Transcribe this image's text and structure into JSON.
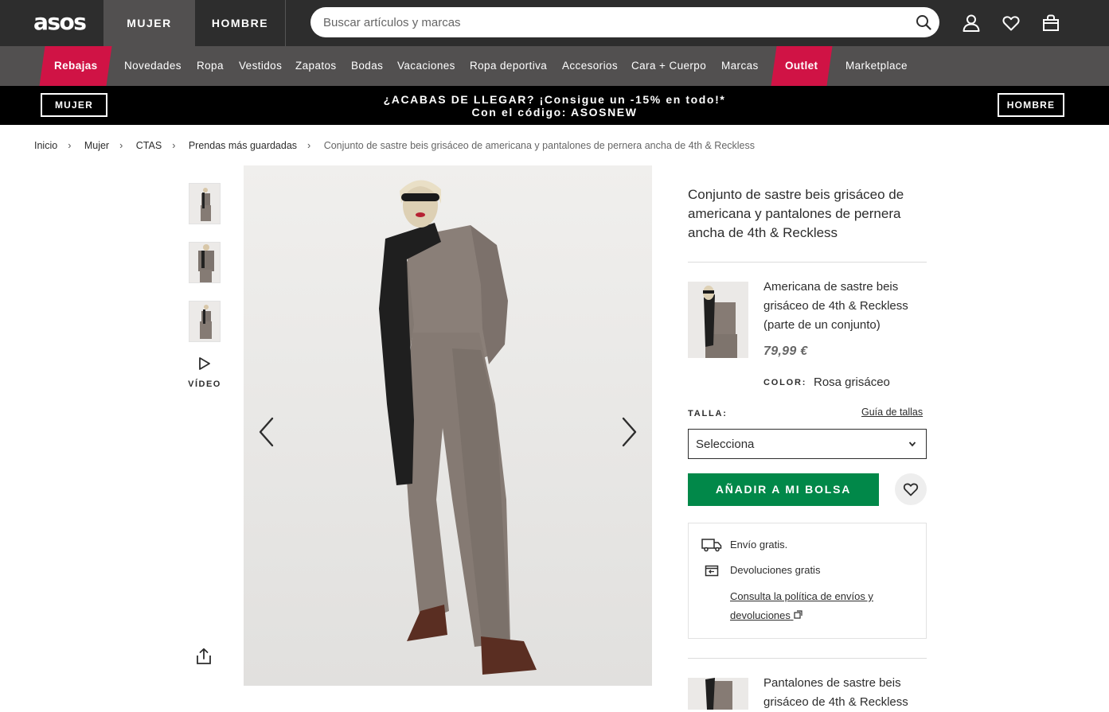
{
  "header": {
    "logo": "asos",
    "tabs": [
      "MUJER",
      "HOMBRE"
    ],
    "search_placeholder": "Buscar artículos y marcas",
    "icons": [
      "account-icon",
      "heart-icon",
      "bag-icon"
    ]
  },
  "categories": {
    "items": [
      "Rebajas",
      "Novedades",
      "Ropa",
      "Vestidos",
      "Zapatos",
      "Bodas",
      "Vacaciones",
      "Ropa deportiva",
      "Accesorios",
      "Cara + Cuerpo",
      "Marcas",
      "Outlet",
      "Marketplace"
    ],
    "highlight_color": "#d01345"
  },
  "promo": {
    "left_button": "MUJER",
    "right_button": "HOMBRE",
    "line1": "¿ACABAS DE LLEGAR? ¡Consigue un -15% en todo!*",
    "line2": "Con el código: ASOSNEW"
  },
  "breadcrumb": [
    "Inicio",
    "Mujer",
    "CTAS",
    "Prendas más guardadas",
    "Conjunto de sastre beis grisáceo de americana y pantalones de pernera ancha de 4th & Reckless"
  ],
  "gallery": {
    "video_label": "VÍDEO"
  },
  "product": {
    "title": "Conjunto de sastre beis grisáceo de americana y pantalones de pernera ancha de 4th & Reckless",
    "item1": {
      "name": "Americana de sastre beis grisáceo de 4th & Reckless (parte de un conjunto)",
      "price": "79,99 €",
      "color_label": "COLOR:",
      "color_value": "Rosa grisáceo"
    },
    "size_label": "TALLA:",
    "size_guide": "Guía de tallas",
    "size_select": "Selecciona",
    "add_button": "AÑADIR A MI BOLSA",
    "add_color": "#018849",
    "delivery": {
      "free_shipping": "Envío gratis.",
      "free_returns": "Devoluciones gratis",
      "policy_link": "Consulta la política de envíos y devoluciones"
    },
    "item2": {
      "name": "Pantalones de sastre beis grisáceo de 4th & Reckless"
    }
  }
}
